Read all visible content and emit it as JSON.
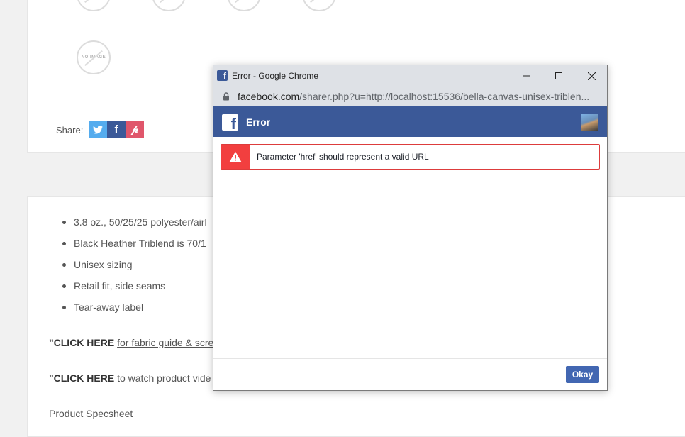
{
  "background_page": {
    "no_image_label": "NO IMAGE",
    "share_label": "Share:",
    "share_buttons": [
      {
        "icon": "twitter-icon",
        "glyph": "🐦",
        "color": "#55acee"
      },
      {
        "icon": "facebook-icon",
        "glyph": "f",
        "color": "#3b5998"
      },
      {
        "icon": "pinterest-icon",
        "glyph": "p",
        "color": "#e0566b"
      }
    ],
    "bullets": [
      "3.8 oz., 50/25/25 polyester/airl",
      "Black Heather Triblend is 70/1",
      "Unisex sizing",
      "Retail fit, side seams",
      "Tear-away label"
    ],
    "para1_bold": "\"CLICK HERE",
    "para1_link": "for fabric guide & scre",
    "para2_bold": "\"CLICK HERE",
    "para2_text": "to watch product vide",
    "para3_text": "Product Specsheet"
  },
  "popup": {
    "window_title": "Error - Google Chrome",
    "url_host": "facebook.com",
    "url_path": "/sharer.php?u=http://localhost:15536/bella-canvas-unisex-triblen...",
    "header_title": "Error",
    "error_message": "Parameter 'href' should represent a valid URL",
    "okay_label": "Okay",
    "colors": {
      "fb_blue": "#3b5998",
      "alert_red": "#f23f3f",
      "button_blue": "#4267b2"
    }
  }
}
